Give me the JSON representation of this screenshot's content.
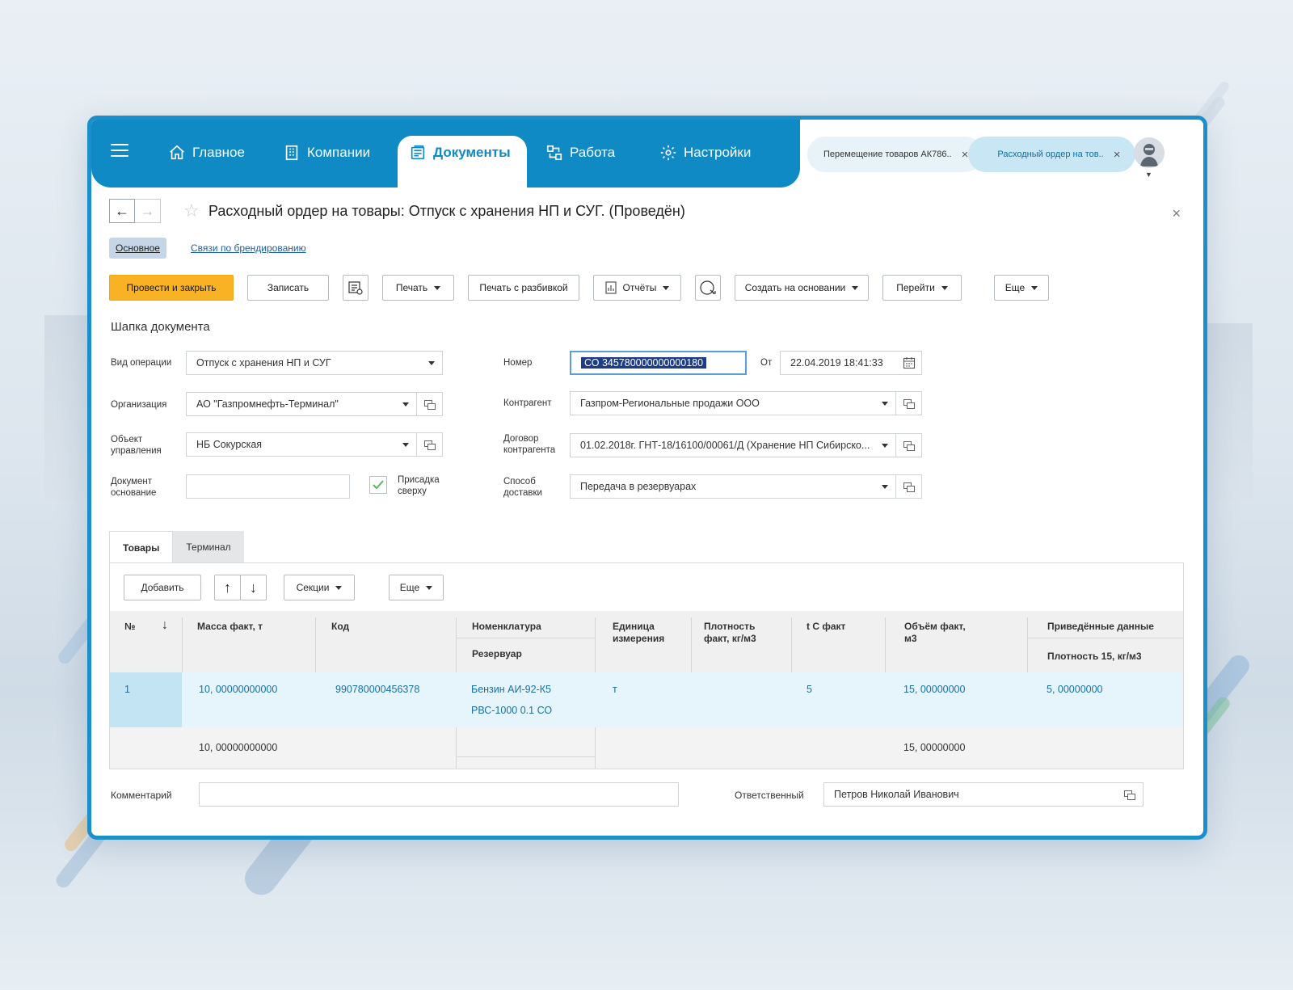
{
  "nav": {
    "items": [
      {
        "label": "Главное"
      },
      {
        "label": "Компании"
      },
      {
        "label": "Документы"
      },
      {
        "label": "Работа"
      },
      {
        "label": "Настройки"
      }
    ]
  },
  "open_tabs": [
    {
      "label": "Перемещение товаров АК786.."
    },
    {
      "label": "Расходный ордер на тов.."
    }
  ],
  "doc": {
    "title": "Расходный ордер на товары: Отпуск с хранения НП и СУГ. (Проведён)"
  },
  "sections": {
    "main": "Основное",
    "link": "Связи по брендированию"
  },
  "toolbar": {
    "post_close": "Провести и закрыть",
    "save": "Записать",
    "print": "Печать",
    "print_split": "Печать с разбивкой",
    "reports": "Отчёты",
    "create_based": "Создать на основании",
    "goto": "Перейти",
    "more": "Еще"
  },
  "header": {
    "title": "Шапка документа",
    "op_type_label": "Вид операции",
    "op_type_value": "Отпуск с хранения НП и СУГ",
    "org_label": "Организация",
    "org_value": "АО \"Газпромнефть-Терминал\"",
    "obj_label_1": "Объект",
    "obj_label_2": "управления",
    "obj_value": "НБ Сокурская",
    "base_doc_label_1": "Документ",
    "base_doc_label_2": "основание",
    "base_doc_value": "",
    "additive_label_1": "Присадка",
    "additive_label_2": "сверху",
    "number_label": "Номер",
    "number_value": "СО 345780000000000180",
    "from_label": "От",
    "date_value": "22.04.2019  18:41:33",
    "counterparty_label": "Контрагент",
    "counterparty_value": "Газпром-Региональные продажи ООО",
    "contract_label_1": "Договор",
    "contract_label_2": "контрагента",
    "contract_value": "01.02.2018г. ГНТ-18/16100/00061/Д (Хранение НП Сибирско...",
    "delivery_label_1": "Способ",
    "delivery_label_2": "доставки",
    "delivery_value": "Передача в резервуарах"
  },
  "inner_tabs": [
    "Товары",
    "Терминал"
  ],
  "table_toolbar": {
    "add": "Добавить",
    "sections": "Секции",
    "more": "Еще"
  },
  "table": {
    "headers": {
      "num": "№",
      "mass": "Масса факт, т",
      "code": "Код",
      "nomenclature": "Номенклатура",
      "tank": "Резервуар",
      "unit_1": "Единица",
      "unit_2": "измерения",
      "density_1": "Плотность",
      "density_2": "факт, кг/м3",
      "temp": "t С факт",
      "volume_1": "Объём факт,",
      "volume_2": "м3",
      "reduced": "Приведённые данные",
      "density15": "Плотность 15, кг/м3"
    },
    "rows": [
      {
        "num": "1",
        "mass": "10, 00000000000",
        "code": "990780000456378",
        "nomenclature": "Бензин АИ-92-К5",
        "tank": "РВС-1000  0.1 СО",
        "unit": "т",
        "density": "",
        "temp": "5",
        "volume": "15, 00000000",
        "density15": "5, 00000000"
      }
    ],
    "totals": {
      "mass": "10, 00000000000",
      "volume": "15, 00000000"
    }
  },
  "footer": {
    "comment_label": "Комментарий",
    "comment_value": "",
    "responsible_label": "Ответственный",
    "responsible_value": "Петров Николай Иванович"
  },
  "colors": {
    "brand": "#0f8ac4",
    "primary_button": "#f9b224",
    "selected_row": "#e6f4fb"
  }
}
